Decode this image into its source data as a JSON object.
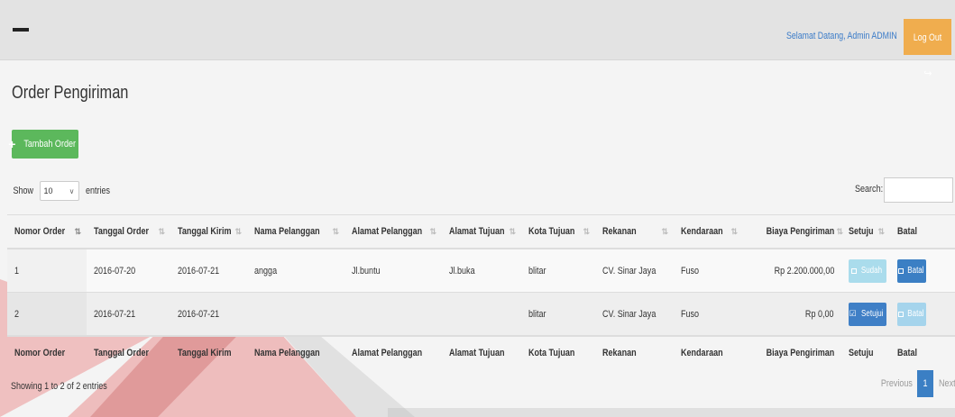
{
  "header": {
    "welcome": "Selamat Datang, Admin ADMIN",
    "logout_label": "Log Out",
    "logout_icon": "sign-out-icon"
  },
  "page": {
    "title": "Order Pengiriman",
    "add_button": "Tambah Order"
  },
  "controls": {
    "show_label": "Show",
    "entries_value": "10",
    "entries_label": "entries",
    "search_label": "Search:",
    "search_value": ""
  },
  "table": {
    "columns": [
      "Nomor Order",
      "Tanggal Order",
      "Tanggal Kirim",
      "Nama Pelanggan",
      "Alamat Pelanggan",
      "Alamat Tujuan",
      "Kota Tujuan",
      "Rekanan",
      "Kendaraan",
      "Biaya Pengiriman",
      "Setuju",
      "Batal"
    ],
    "rows": [
      {
        "nomor": "1",
        "tgl_order": "2016-07-20",
        "tgl_kirim": "2016-07-21",
        "nama": "angga",
        "alamat_pelanggan": "Jl.buntu",
        "alamat_tujuan": "Jl.buka",
        "kota": "blitar",
        "rekanan": "CV. Sinar Jaya",
        "kendaraan": "Fuso",
        "biaya": "Rp 2.200.000,00",
        "setuju": "Sudah",
        "batal": "Batal"
      },
      {
        "nomor": "2",
        "tgl_order": "2016-07-21",
        "tgl_kirim": "2016-07-21",
        "nama": "",
        "alamat_pelanggan": "",
        "alamat_tujuan": "",
        "kota": "blitar",
        "rekanan": "CV. Sinar Jaya",
        "kendaraan": "Fuso",
        "biaya": "Rp 0,00",
        "setuju": "Setujui",
        "batal": "Batal"
      }
    ]
  },
  "footer": {
    "info": "Showing 1 to 2 of 2 entries",
    "prev": "Previous",
    "page": "1",
    "next": "Next"
  },
  "colors": {
    "accent_blue": "#3b7fc4",
    "success_green": "#5cb85c",
    "warning_orange": "#f0ad4e",
    "watermark_red": "#d32f2f"
  }
}
